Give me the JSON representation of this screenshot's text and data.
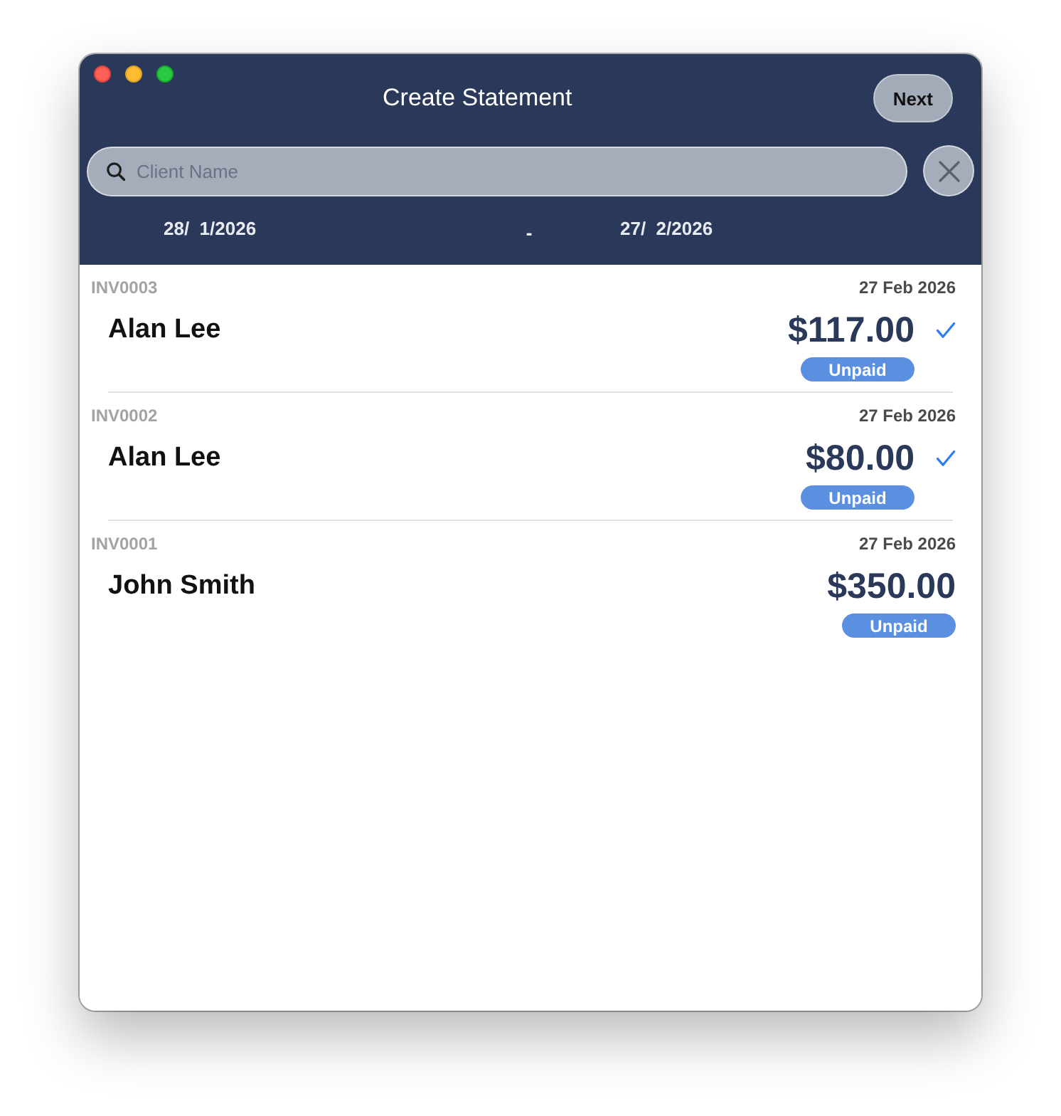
{
  "window": {
    "title": "Create Statement"
  },
  "toolbar": {
    "next_button": "Next"
  },
  "search": {
    "placeholder": "Client Name"
  },
  "date_range": {
    "start": "28/  1/2026",
    "separator": "-",
    "end": "27/  2/2026"
  },
  "invoices": [
    {
      "number": "INV0003",
      "date": "27 Feb 2026",
      "client": "Alan Lee",
      "amount": "$117.00",
      "status": "Unpaid",
      "selected": true
    },
    {
      "number": "INV0002",
      "date": "27 Feb 2026",
      "client": "Alan Lee",
      "amount": "$80.00",
      "status": "Unpaid",
      "selected": true
    },
    {
      "number": "INV0001",
      "date": "27 Feb 2026",
      "client": "John Smith",
      "amount": "$350.00",
      "status": "Unpaid",
      "selected": false
    }
  ]
}
